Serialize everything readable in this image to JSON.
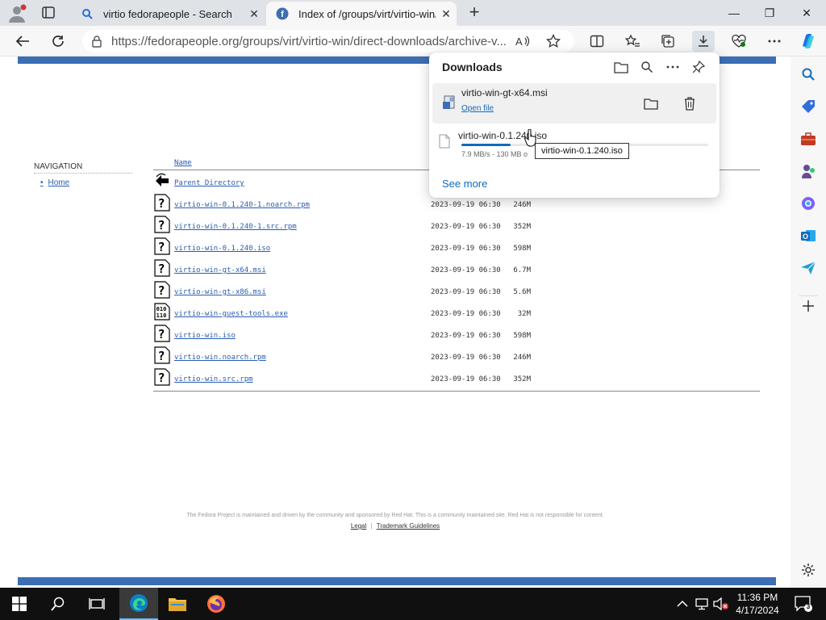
{
  "browser": {
    "tabs": [
      {
        "title": "virtio fedorapeople - Search",
        "active": false
      },
      {
        "title": "Index of /groups/virt/virtio-win/direct-downloads/archive-virtio",
        "active": true
      }
    ],
    "url": "https://fedorapeople.org/groups/virt/virtio-win/direct-downloads/archive-v..."
  },
  "page": {
    "nav_heading": "NAVIGATION",
    "nav_home": "Home",
    "bullet": "•",
    "col_name": "Name",
    "rows": [
      {
        "name": "Parent Directory",
        "date": "",
        "size": "",
        "icon": "back-icon"
      },
      {
        "name": "virtio-win-0.1.240-1.noarch.rpm",
        "date": "2023-09-19 06:30",
        "size": "246M",
        "icon": "unknown-file-icon"
      },
      {
        "name": "virtio-win-0.1.240-1.src.rpm",
        "date": "2023-09-19 06:30",
        "size": "352M",
        "icon": "unknown-file-icon"
      },
      {
        "name": "virtio-win-0.1.240.iso",
        "date": "2023-09-19 06:30",
        "size": "598M",
        "icon": "unknown-file-icon"
      },
      {
        "name": "virtio-win-gt-x64.msi",
        "date": "2023-09-19 06:30",
        "size": "6.7M",
        "icon": "unknown-file-icon"
      },
      {
        "name": "virtio-win-gt-x86.msi",
        "date": "2023-09-19 06:30",
        "size": "5.6M",
        "icon": "unknown-file-icon"
      },
      {
        "name": "virtio-win-guest-tools.exe",
        "date": "2023-09-19 06:30",
        "size": "32M",
        "icon": "binary-file-icon"
      },
      {
        "name": "virtio-win.iso",
        "date": "2023-09-19 06:30",
        "size": "598M",
        "icon": "unknown-file-icon"
      },
      {
        "name": "virtio-win.noarch.rpm",
        "date": "2023-09-19 06:30",
        "size": "246M",
        "icon": "unknown-file-icon"
      },
      {
        "name": "virtio-win.src.rpm",
        "date": "2023-09-19 06:30",
        "size": "352M",
        "icon": "unknown-file-icon"
      }
    ],
    "footer_text": "The Fedora Project is maintained and driven by the community and sponsored by Red Hat. This is a community maintained site. Red Hat is not responsible for content.",
    "footer_legal": "Legal",
    "footer_sep": "|",
    "footer_trademark": "Trademark Guidelines"
  },
  "downloads": {
    "title": "Downloads",
    "items": [
      {
        "filename": "virtio-win-gt-x64.msi",
        "action": "Open file"
      },
      {
        "filename": "virtio-win-0.1.240.iso",
        "status": "7.9 MB/s - 130 MB o",
        "progress": 0.2
      }
    ],
    "see_more": "See more",
    "tooltip": "virtio-win-0.1.240.iso"
  },
  "taskbar": {
    "time": "11:36 PM",
    "date": "4/17/2024",
    "notification_count": "3"
  },
  "colors": {
    "fedora_blue": "#3c6eb4",
    "link": "#2a5db0",
    "edge_accent": "#0f6cbd"
  }
}
